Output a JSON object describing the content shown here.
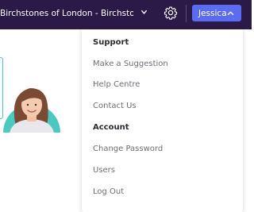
{
  "topbar": {
    "org_name": "Birchstones of London - Birchstones...",
    "user_label": "Jessica",
    "icons": {
      "org_chevron": "chevron-down-icon",
      "settings": "gear-icon",
      "user_chevron": "chevron-up-icon"
    }
  },
  "menu": {
    "support_heading": "Support",
    "support_items": [
      "Make a Suggestion",
      "Help Centre",
      "Contact Us"
    ],
    "account_heading": "Account",
    "account_items": [
      "Change Password",
      "Users",
      "Log Out"
    ]
  },
  "colors": {
    "topbar": "#2b1a47",
    "user_button": "#5a6df2",
    "accent_teal": "#4bc9c1"
  }
}
